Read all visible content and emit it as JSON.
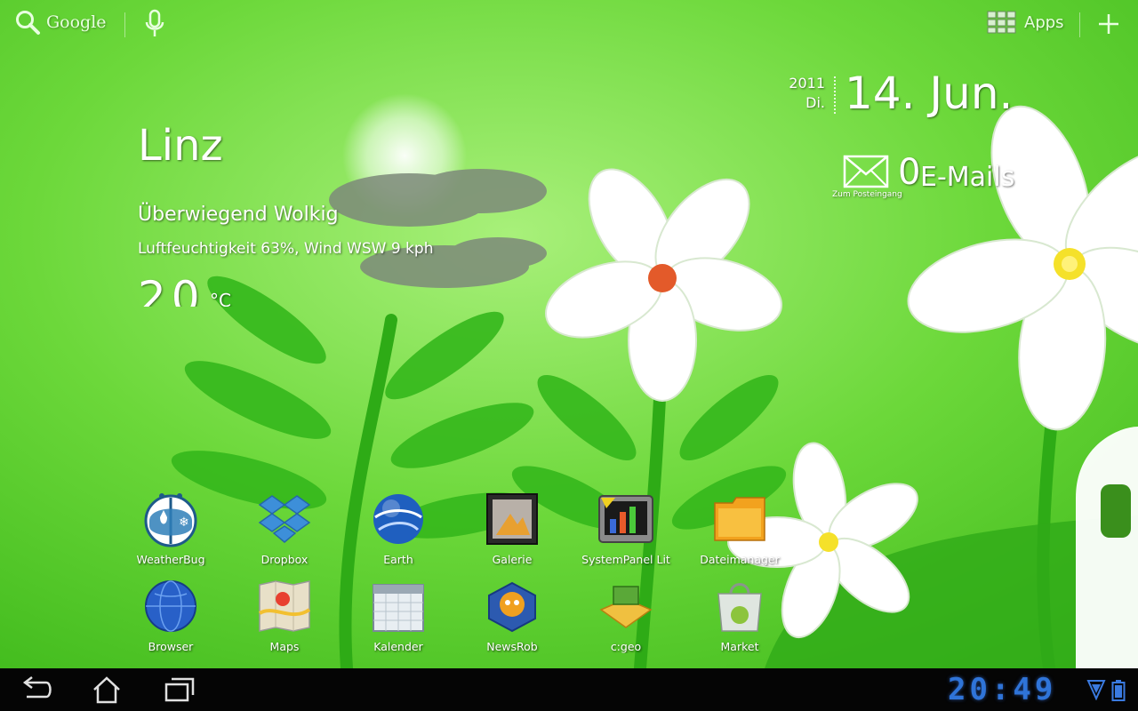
{
  "search": {
    "label": "Google"
  },
  "apps_button": {
    "label": "Apps"
  },
  "date": {
    "year": "2011",
    "weekday": "Di.",
    "day_month": "14. Jun."
  },
  "email": {
    "count": "0",
    "label": "E-Mails",
    "sub": "Zum Posteingang"
  },
  "weather": {
    "city": "Linz",
    "condition": "Überwiegend Wolkig",
    "details": "Luftfeuchtigkeit 63%, Wind WSW 9 kph",
    "temperature": "20",
    "unit": "°C"
  },
  "apps": [
    {
      "name": "WeatherBug",
      "icon": "weatherbug-icon"
    },
    {
      "name": "Dropbox",
      "icon": "dropbox-icon"
    },
    {
      "name": "Earth",
      "icon": "earth-icon"
    },
    {
      "name": "Galerie",
      "icon": "gallery-icon"
    },
    {
      "name": "SystemPanel Lit",
      "icon": "systempanel-icon"
    },
    {
      "name": "Dateimanager",
      "icon": "folder-icon"
    },
    {
      "name": "Browser",
      "icon": "globe-icon"
    },
    {
      "name": "Maps",
      "icon": "maps-icon"
    },
    {
      "name": "Kalender",
      "icon": "calendar-icon"
    },
    {
      "name": "NewsRob",
      "icon": "newsrob-icon"
    },
    {
      "name": "c:geo",
      "icon": "cgeo-icon"
    },
    {
      "name": "Market",
      "icon": "market-icon"
    }
  ],
  "status": {
    "time": "20:49"
  },
  "colors": {
    "wallpaper": "#5fd12a",
    "clock": "#2f74d8",
    "system_bar": "#050505"
  }
}
